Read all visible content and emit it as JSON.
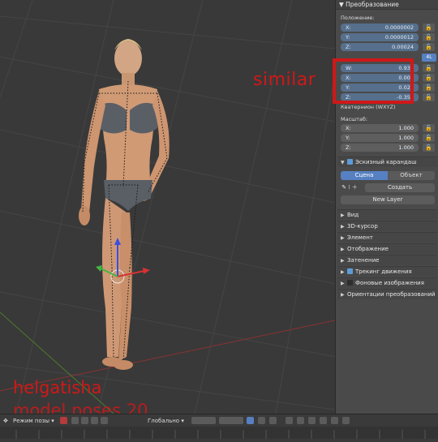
{
  "watermark": {
    "line1": "helgatisha",
    "line2": "model poses 20",
    "highlight_note": "similar"
  },
  "colors": {
    "accent": "#d01818",
    "field_blue": "#566f8c",
    "tab_active": "#5680c2"
  },
  "panel": {
    "transform_header": "Преобразование",
    "location": {
      "label": "Положение:",
      "rows": [
        {
          "axis": "X:",
          "value": "0.0000002"
        },
        {
          "axis": "Y:",
          "value": "0.0000012"
        },
        {
          "axis": "Z:",
          "value": "0.00024"
        }
      ]
    },
    "mode_button": "4L",
    "rotation": {
      "rows": [
        {
          "axis": "W:",
          "value": "0.934"
        },
        {
          "axis": "X:",
          "value": "0.001"
        },
        {
          "axis": "Y:",
          "value": "0.021"
        },
        {
          "axis": "Z:",
          "value": "-0.356"
        }
      ],
      "mode_label": "Кватернион (WXYZ)"
    },
    "scale": {
      "label": "Масштаб:",
      "rows": [
        {
          "axis": "X:",
          "value": "1.000"
        },
        {
          "axis": "Y:",
          "value": "1.000"
        },
        {
          "axis": "Z:",
          "value": "1.000"
        }
      ]
    },
    "grease_pencil": {
      "header": "Эскизный карандаш",
      "tabs": [
        "Сцена",
        "Объект"
      ],
      "create": "Создать",
      "new_layer": "New Layer"
    },
    "sections": [
      {
        "label": "Вид",
        "checkbox": null
      },
      {
        "label": "3D-курсор",
        "checkbox": null
      },
      {
        "label": "Элемент",
        "checkbox": null
      },
      {
        "label": "Отображение",
        "checkbox": null
      },
      {
        "label": "Затенение",
        "checkbox": null
      },
      {
        "label": "Трекинг движения",
        "checkbox": "on"
      },
      {
        "label": "Фоновые изображения",
        "checkbox": "off"
      },
      {
        "label": "Ориентации преобразований",
        "checkbox": null
      }
    ]
  },
  "statusbar": {
    "mode": "Режим позы",
    "orientation": "Глобально"
  }
}
